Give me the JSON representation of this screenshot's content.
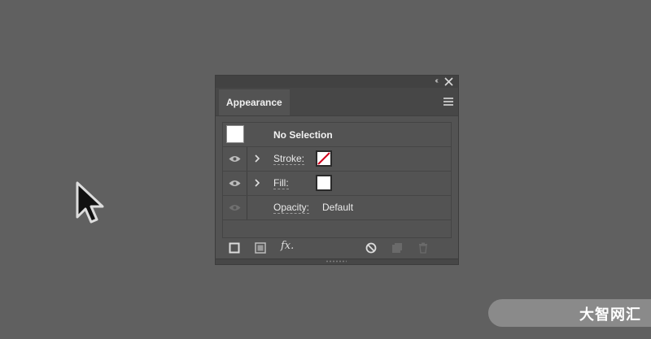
{
  "panel": {
    "collapse_glyph": "‹‹",
    "tab_label": "Appearance",
    "rows": {
      "selection_label": "No Selection",
      "stroke_label": "Stroke:",
      "fill_label": "Fill:",
      "opacity_label": "Opacity:",
      "opacity_value": "Default"
    },
    "toolbar": {
      "fx_label": "fx."
    }
  },
  "watermark": "大智网汇",
  "colors": {
    "background": "#606060",
    "panel": "#535353",
    "stroke_none_slash": "#d0021b"
  }
}
